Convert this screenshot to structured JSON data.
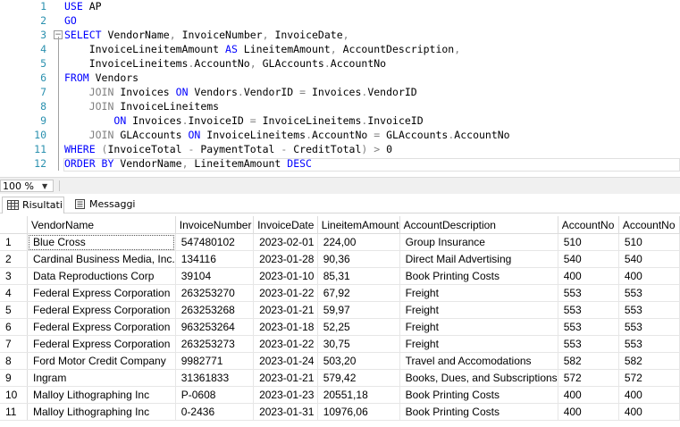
{
  "editor": {
    "lines": [
      {
        "n": "1",
        "fold": "",
        "tokens": [
          {
            "t": "USE ",
            "c": "kw"
          },
          {
            "t": "AP",
            "c": ""
          }
        ]
      },
      {
        "n": "2",
        "fold": "",
        "tokens": [
          {
            "t": "GO",
            "c": "kw"
          }
        ]
      },
      {
        "n": "3",
        "fold": "−",
        "tokens": [
          {
            "t": "SELECT ",
            "c": "kw"
          },
          {
            "t": "VendorName",
            "c": ""
          },
          {
            "t": ", ",
            "c": "op"
          },
          {
            "t": "InvoiceNumber",
            "c": ""
          },
          {
            "t": ", ",
            "c": "op"
          },
          {
            "t": "InvoiceDate",
            "c": ""
          },
          {
            "t": ",",
            "c": "op"
          }
        ]
      },
      {
        "n": "4",
        "fold": "",
        "tokens": [
          {
            "t": "    InvoiceLineitemAmount ",
            "c": ""
          },
          {
            "t": "AS ",
            "c": "kw"
          },
          {
            "t": "LineitemAmount",
            "c": ""
          },
          {
            "t": ", ",
            "c": "op"
          },
          {
            "t": "AccountDescription",
            "c": ""
          },
          {
            "t": ",",
            "c": "op"
          }
        ]
      },
      {
        "n": "5",
        "fold": "",
        "tokens": [
          {
            "t": "    InvoiceLineitems",
            "c": ""
          },
          {
            "t": ".",
            "c": "op"
          },
          {
            "t": "AccountNo",
            "c": ""
          },
          {
            "t": ", ",
            "c": "op"
          },
          {
            "t": "GLAccounts",
            "c": ""
          },
          {
            "t": ".",
            "c": "op"
          },
          {
            "t": "AccountNo",
            "c": ""
          }
        ]
      },
      {
        "n": "6",
        "fold": "",
        "tokens": [
          {
            "t": "FROM ",
            "c": "kw"
          },
          {
            "t": "Vendors",
            "c": ""
          }
        ]
      },
      {
        "n": "7",
        "fold": "",
        "tokens": [
          {
            "t": "    ",
            "c": ""
          },
          {
            "t": "JOIN ",
            "c": "op"
          },
          {
            "t": "Invoices ",
            "c": ""
          },
          {
            "t": "ON ",
            "c": "kw"
          },
          {
            "t": "Vendors",
            "c": ""
          },
          {
            "t": ".",
            "c": "op"
          },
          {
            "t": "VendorID ",
            "c": ""
          },
          {
            "t": "= ",
            "c": "op"
          },
          {
            "t": "Invoices",
            "c": ""
          },
          {
            "t": ".",
            "c": "op"
          },
          {
            "t": "VendorID",
            "c": ""
          }
        ]
      },
      {
        "n": "8",
        "fold": "",
        "tokens": [
          {
            "t": "    ",
            "c": ""
          },
          {
            "t": "JOIN ",
            "c": "op"
          },
          {
            "t": "InvoiceLineitems",
            "c": ""
          }
        ]
      },
      {
        "n": "9",
        "fold": "",
        "tokens": [
          {
            "t": "        ",
            "c": ""
          },
          {
            "t": "ON ",
            "c": "kw"
          },
          {
            "t": "Invoices",
            "c": ""
          },
          {
            "t": ".",
            "c": "op"
          },
          {
            "t": "InvoiceID ",
            "c": ""
          },
          {
            "t": "= ",
            "c": "op"
          },
          {
            "t": "InvoiceLineitems",
            "c": ""
          },
          {
            "t": ".",
            "c": "op"
          },
          {
            "t": "InvoiceID",
            "c": ""
          }
        ]
      },
      {
        "n": "10",
        "fold": "",
        "tokens": [
          {
            "t": "    ",
            "c": ""
          },
          {
            "t": "JOIN ",
            "c": "op"
          },
          {
            "t": "GLAccounts ",
            "c": ""
          },
          {
            "t": "ON ",
            "c": "kw"
          },
          {
            "t": "InvoiceLineitems",
            "c": ""
          },
          {
            "t": ".",
            "c": "op"
          },
          {
            "t": "AccountNo ",
            "c": ""
          },
          {
            "t": "= ",
            "c": "op"
          },
          {
            "t": "GLAccounts",
            "c": ""
          },
          {
            "t": ".",
            "c": "op"
          },
          {
            "t": "AccountNo",
            "c": ""
          }
        ]
      },
      {
        "n": "11",
        "fold": "",
        "tokens": [
          {
            "t": "WHERE ",
            "c": "kw"
          },
          {
            "t": "(",
            "c": "op"
          },
          {
            "t": "InvoiceTotal ",
            "c": ""
          },
          {
            "t": "- ",
            "c": "op"
          },
          {
            "t": "PaymentTotal ",
            "c": ""
          },
          {
            "t": "- ",
            "c": "op"
          },
          {
            "t": "CreditTotal",
            "c": ""
          },
          {
            "t": ") ",
            "c": "op"
          },
          {
            "t": "> ",
            "c": "op"
          },
          {
            "t": "0",
            "c": ""
          }
        ]
      },
      {
        "n": "12",
        "fold": "",
        "tokens": [
          {
            "t": "ORDER BY ",
            "c": "kw"
          },
          {
            "t": "VendorName",
            "c": ""
          },
          {
            "t": ", ",
            "c": "op"
          },
          {
            "t": "LineitemAmount ",
            "c": ""
          },
          {
            "t": "DESC",
            "c": "kw"
          }
        ]
      }
    ],
    "colors": {
      "keyword": "#0000ff",
      "operator": "#808080",
      "line_number": "#2b91af"
    }
  },
  "zoom": {
    "value": "100 %"
  },
  "tabs": [
    {
      "label": "Risultati",
      "icon": "grid-icon",
      "active": true
    },
    {
      "label": "Messaggi",
      "icon": "messages-icon",
      "active": false
    }
  ],
  "results": {
    "columns": [
      "VendorName",
      "InvoiceNumber",
      "InvoiceDate",
      "LineitemAmount",
      "AccountDescription",
      "AccountNo",
      "AccountNo"
    ],
    "rows": [
      [
        "1",
        "Blue Cross",
        "547480102",
        "2023-02-01",
        "224,00",
        "Group Insurance",
        "510",
        "510"
      ],
      [
        "2",
        "Cardinal Business Media, Inc.",
        "134116",
        "2023-01-28",
        "90,36",
        "Direct Mail Advertising",
        "540",
        "540"
      ],
      [
        "3",
        "Data Reproductions Corp",
        "39104",
        "2023-01-10",
        "85,31",
        "Book Printing Costs",
        "400",
        "400"
      ],
      [
        "4",
        "Federal Express Corporation",
        "263253270",
        "2023-01-22",
        "67,92",
        "Freight",
        "553",
        "553"
      ],
      [
        "5",
        "Federal Express Corporation",
        "263253268",
        "2023-01-21",
        "59,97",
        "Freight",
        "553",
        "553"
      ],
      [
        "6",
        "Federal Express Corporation",
        "963253264",
        "2023-01-18",
        "52,25",
        "Freight",
        "553",
        "553"
      ],
      [
        "7",
        "Federal Express Corporation",
        "263253273",
        "2023-01-22",
        "30,75",
        "Freight",
        "553",
        "553"
      ],
      [
        "8",
        "Ford Motor Credit Company",
        "9982771",
        "2023-01-24",
        "503,20",
        "Travel and Accomodations",
        "582",
        "582"
      ],
      [
        "9",
        "Ingram",
        "31361833",
        "2023-01-21",
        "579,42",
        "Books, Dues, and Subscriptions",
        "572",
        "572"
      ],
      [
        "10",
        "Malloy Lithographing Inc",
        "P-0608",
        "2023-01-23",
        "20551,18",
        "Book Printing Costs",
        "400",
        "400"
      ],
      [
        "11",
        "Malloy Lithographing Inc",
        "0-2436",
        "2023-01-31",
        "10976,06",
        "Book Printing Costs",
        "400",
        "400"
      ]
    ]
  }
}
